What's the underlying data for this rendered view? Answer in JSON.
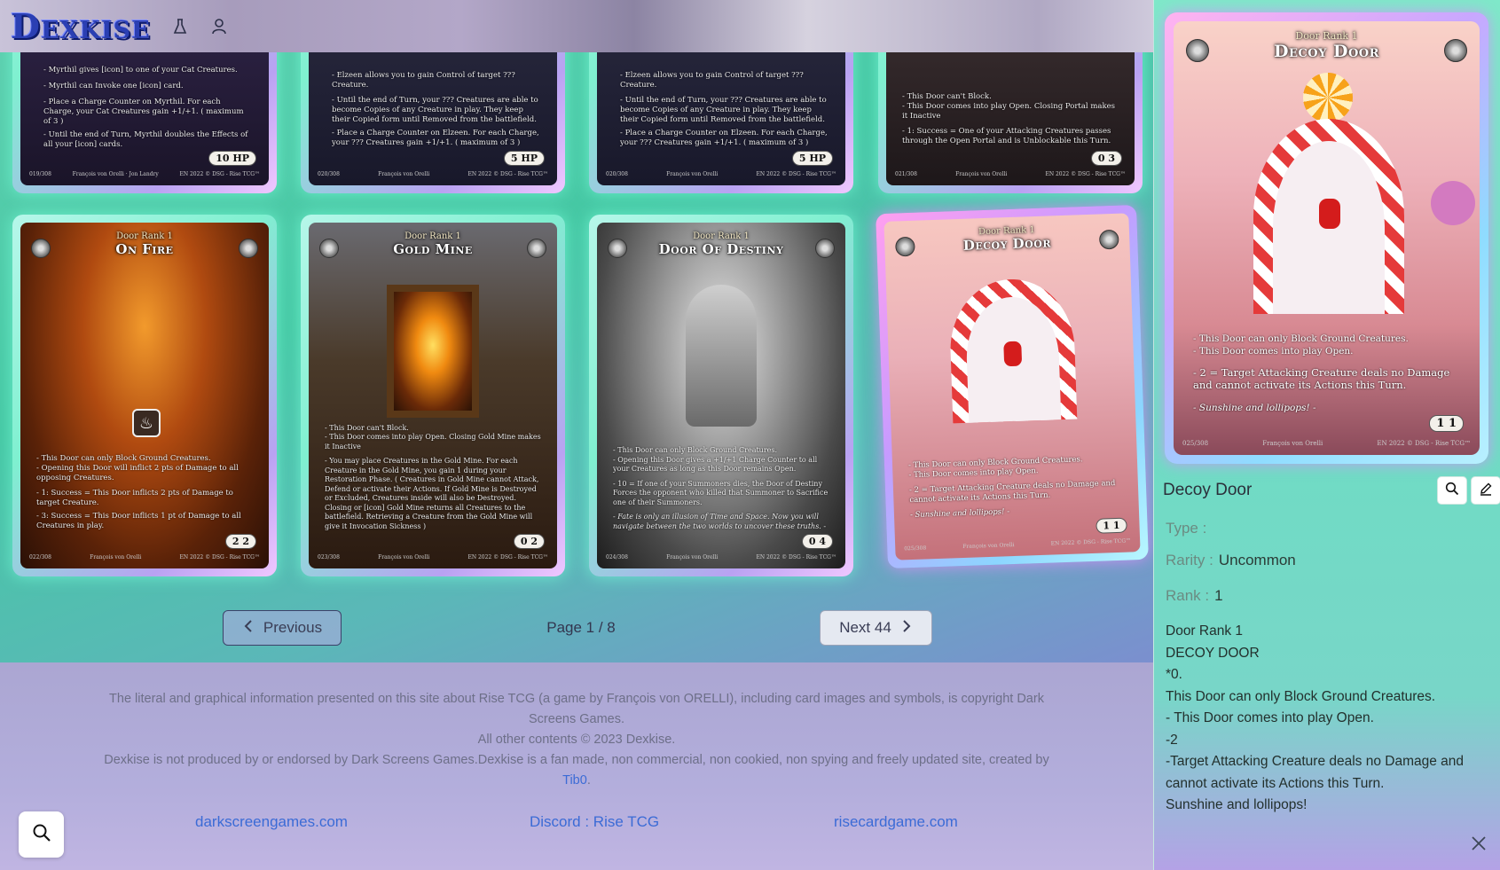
{
  "header": {
    "logo": "Dexkise",
    "icons": [
      "flask-icon",
      "user-icon"
    ]
  },
  "cards": [
    {
      "name": "",
      "rank": "",
      "text": [
        "- Myrthil gives [icon] to one of your Cat Creatures.",
        "- Myrthil can Invoke one [icon] card.",
        "- Place a Charge Counter on Myrthil. For each Charge, your Cat Creatures gain +1/+1. ( maximum of 3 )",
        "- Until the end of Turn, Myrthil doubles the Effects of all your [icon] cards."
      ],
      "stat": "10 HP",
      "number": "019/308",
      "artist": "François von Orelli · Jon Landry",
      "legal": "EN 2022 © DSG - Rise TCG™"
    },
    {
      "name": "",
      "rank": "",
      "text": [
        "- Elzeen allows you to gain Control of target ??? Creature.",
        "- Until the end of Turn, your ??? Creatures are able to become Copies of any Creature in play. They keep their Copied form until Removed from the battlefield.",
        "- Place a Charge Counter on Elzeen. For each Charge, your ??? Creatures gain +1/+1. ( maximum of 3 )"
      ],
      "stat": "5 HP",
      "number": "020/308",
      "artist": "François von Orelli",
      "legal": "EN 2022 © DSG - Rise TCG™"
    },
    {
      "name": "",
      "rank": "",
      "text": [
        "- Elzeen allows you to gain Control of target ??? Creature.",
        "- Until the end of Turn, your ??? Creatures are able to become Copies of any Creature in play. They keep their Copied form until Removed from the battlefield.",
        "- Place a Charge Counter on Elzeen. For each Charge, your ??? Creatures gain +1/+1. ( maximum of 3 )"
      ],
      "stat": "5 HP",
      "number": "020/308",
      "artist": "François von Orelli",
      "legal": "EN 2022 © DSG - Rise TCG™"
    },
    {
      "name": "",
      "rank": "",
      "text": [
        "- This Door can't Block.",
        "- This Door comes into play Open. Closing Portal makes it Inactive",
        "- 1: Success = One of your Attacking Creatures passes through the Open Portal and is Unblockable this Turn."
      ],
      "stat": "0 3",
      "number": "021/308",
      "artist": "François von Orelli",
      "legal": "EN 2022 © DSG - Rise TCG™"
    },
    {
      "name": "On Fire",
      "rank": "Door Rank 1",
      "text": [
        "- This Door can only Block Ground Creatures.",
        "- Opening this Door will inflict 2 pts of Damage to all opposing Creatures.",
        "- 1: Success = This Door inflicts 2 pts of Damage to target Creature.",
        "- 3: Success = This Door inflicts 1 pt of Damage to all Creatures in play."
      ],
      "stat": "2 2",
      "number": "022/308",
      "artist": "François von Orelli",
      "legal": "EN 2022 © DSG - Rise TCG™"
    },
    {
      "name": "Gold Mine",
      "rank": "Door Rank 1",
      "text": [
        "- This Door can't Block.",
        "- This Door comes into play Open. Closing Gold Mine makes it Inactive",
        "- You may place Creatures in the Gold Mine. For each Creature in the Gold Mine, you gain 1 during your Restoration Phase. ( Creatures in Gold Mine cannot Attack, Defend or activate their Actions. If Gold Mine is Destroyed or Excluded, Creatures inside will also be Destroyed. Closing or [icon] Gold Mine returns all Creatures to the battlefield. Retrieving a Creature from the Gold Mine will give it Invocation Sickness )"
      ],
      "stat": "0 2",
      "number": "023/308",
      "artist": "François von Orelli",
      "legal": "EN 2022 © DSG - Rise TCG™"
    },
    {
      "name": "Door Of Destiny",
      "rank": "Door Rank 1",
      "text": [
        "- This Door can only Block Ground Creatures.",
        "- Opening this Door gives a +1/+1 Charge Counter to all your Creatures as long as this Door remains Open.",
        "- 10 = If one of your Summoners dies, the Door of Destiny Forces the opponent who killed that Summoner to Sacrifice one of their Summoners.",
        "- Fate is only an illusion of Time and Space. Now you will navigate between the two worlds to uncover these truths. -"
      ],
      "stat": "0 4",
      "number": "024/308",
      "artist": "François von Orelli",
      "legal": "EN 2022 © DSG - Rise TCG™"
    },
    {
      "name": "Decoy Door",
      "rank": "Door Rank 1",
      "text": [
        "- This Door can only Block Ground Creatures.",
        "- This Door comes into play Open.",
        "- 2 = Target Attacking Creature deals no Damage and cannot activate its Actions this Turn.",
        "- Sunshine and lollipops! -"
      ],
      "stat": "1 1",
      "number": "025/308",
      "artist": "François von Orelli",
      "legal": "EN 2022 © DSG - Rise TCG™"
    }
  ],
  "pagination": {
    "previous_label": "Previous",
    "page_label": "Page 1 / 8",
    "next_label": "Next 44"
  },
  "footer": {
    "notice_1": "The literal and graphical information presented on this site about Rise TCG (a game by François von ORELLI), including card images and symbols, is copyright Dark Screens Games.",
    "notice_2": "All other contents © 2023 Dexkise.",
    "notice_3": "Dexkise is not produced by or endorsed by Dark Screens Games.Dexkise is a fan made, non commercial, non cookied, non spying and freely updated site, created by",
    "creator_link": "Tib0",
    "period": ".",
    "links": [
      "darkscreengames.com",
      "Discord : Rise TCG",
      "risecardgame.com"
    ]
  },
  "side_panel": {
    "preview": {
      "rank": "Door Rank 1",
      "name": "Decoy Door",
      "text": [
        "- This Door can only Block Ground Creatures.",
        "- This Door comes into play Open.",
        "- 2 = Target Attacking Creature deals no Damage and cannot activate its Actions this Turn.",
        "- Sunshine and lollipops! -"
      ],
      "stat": "1 1",
      "number": "025/308",
      "artist": "François von Orelli",
      "legal": "EN 2022 © DSG - Rise TCG™"
    },
    "title": "Decoy Door",
    "type_label": "Type :",
    "type_value": "",
    "rarity_label": "Rarity :",
    "rarity_value": "Uncommon",
    "rank_label": "Rank :",
    "rank_value": "1",
    "card_text": [
      "Door Rank 1",
      "DECOY DOOR",
      "*0.",
      "This Door can only Block Ground Creatures.",
      "- This Door comes into play Open.",
      "-2",
      "-Target Attacking Creature deals no Damage and cannot activate its Actions this Turn.",
      "Sunshine and lollipops!"
    ]
  }
}
